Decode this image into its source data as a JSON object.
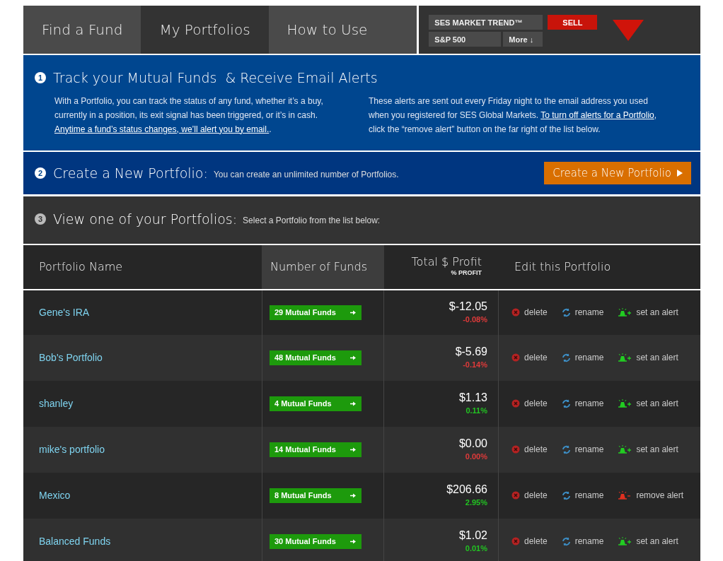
{
  "tabs": [
    {
      "label": "Find a Fund",
      "selected": false
    },
    {
      "label": "My Portfolios",
      "selected": true
    },
    {
      "label": "How to Use",
      "selected": false
    }
  ],
  "market": {
    "label": "SES MARKET TREND™",
    "signal": "SELL",
    "falling": true,
    "index": "S&P 500",
    "more": "More ↓"
  },
  "track": {
    "number": "1",
    "title": "Track your Mutual Funds  & Receive Email Alerts",
    "left_text": "With a Portfolio, you can track the status of any fund, whether it’s a buy, currently in a position, its exit signal has been triggered, or it’s in cash.",
    "left_link": "Anytime a fund’s status changes, we’ll alert you by email.",
    "left_after": ".",
    "right_text": "These alerts are sent out every Friday night to the email address you used when you registered for SES Global Markets.",
    "right_link": "To turn off alerts for a Portfolio",
    "right_after": ", click the “remove alert” button on the far right of the list below."
  },
  "create": {
    "number": "2",
    "title": "Create a New Portfolio:",
    "note": "You can create an unlimited number of Portfolios.",
    "button": "Create a New Portfolio"
  },
  "view": {
    "number": "3",
    "title": "View one of your Portfolios:",
    "note": "Select a Portfolio from the list below:"
  },
  "table": {
    "columns": [
      {
        "label": "Portfolio Name"
      },
      {
        "label": "Number of Funds",
        "selected": true
      },
      {
        "label": "Total $ Profit",
        "sublabel": "% PROFIT"
      },
      {
        "label": "Edit this Portfolio"
      }
    ],
    "rows": [
      {
        "name": "Gene's IRA",
        "funds": "29 Mutual Funds",
        "profit": "$-12.05",
        "percent": "-0.08%",
        "negative": true,
        "delete": "delete",
        "rename": "rename",
        "alert": "set an alert",
        "alert_on": false
      },
      {
        "name": "Bob's Portfolio",
        "funds": "48 Mutual Funds",
        "profit": "$-5.69",
        "percent": "-0.14%",
        "negative": true,
        "delete": "delete",
        "rename": "rename",
        "alert": "set an alert",
        "alert_on": false
      },
      {
        "name": "shanley",
        "funds": "4 Mutual Funds",
        "profit": "$1.13",
        "percent": "0.11%",
        "negative": false,
        "delete": "delete",
        "rename": "rename",
        "alert": "set an alert",
        "alert_on": false
      },
      {
        "name": "mike's portfolio",
        "funds": "14 Mutual Funds",
        "profit": "$0.00",
        "percent": "0.00%",
        "negative": true,
        "delete": "delete",
        "rename": "rename",
        "alert": "set an alert",
        "alert_on": false
      },
      {
        "name": "Mexico",
        "funds": "8 Mutual Funds",
        "profit": "$206.66",
        "percent": "2.95%",
        "negative": false,
        "delete": "delete",
        "rename": "rename",
        "alert": "remove alert",
        "alert_on": true
      },
      {
        "name": "Balanced Funds",
        "funds": "30 Mutual Funds",
        "profit": "$1.02",
        "percent": "0.01%",
        "negative": false,
        "delete": "delete",
        "rename": "rename",
        "alert": "set an alert",
        "alert_on": false
      }
    ]
  }
}
